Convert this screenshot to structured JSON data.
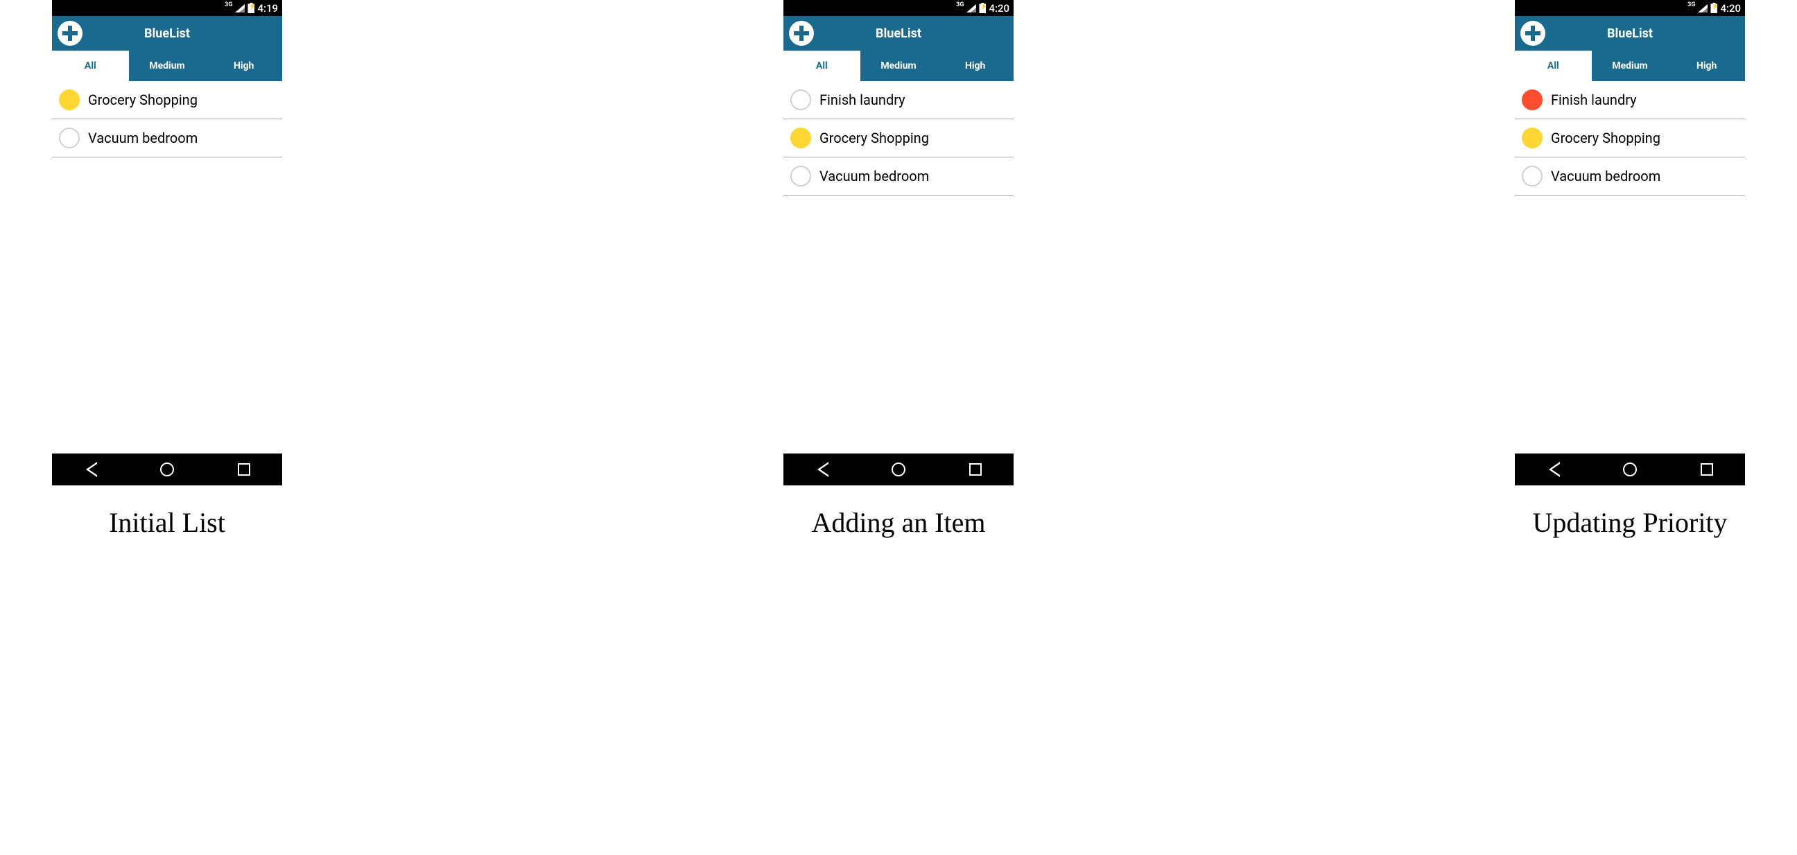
{
  "colors": {
    "header_bg": "#1a6a8f",
    "priority_medium": "#ffd633",
    "priority_high": "#ff4d2e"
  },
  "screens": [
    {
      "caption": "Initial List",
      "status": {
        "network": "3G",
        "time": "4:19"
      },
      "header": {
        "title": "BlueList"
      },
      "tabs": [
        {
          "label": "All",
          "active": true
        },
        {
          "label": "Medium",
          "active": false
        },
        {
          "label": "High",
          "active": false
        }
      ],
      "items": [
        {
          "text": "Grocery Shopping",
          "priority": "medium"
        },
        {
          "text": "Vacuum bedroom",
          "priority": "none"
        }
      ]
    },
    {
      "caption": "Adding an Item",
      "status": {
        "network": "3G",
        "time": "4:20"
      },
      "header": {
        "title": "BlueList"
      },
      "tabs": [
        {
          "label": "All",
          "active": true
        },
        {
          "label": "Medium",
          "active": false
        },
        {
          "label": "High",
          "active": false
        }
      ],
      "items": [
        {
          "text": "Finish laundry",
          "priority": "none"
        },
        {
          "text": "Grocery Shopping",
          "priority": "medium"
        },
        {
          "text": "Vacuum bedroom",
          "priority": "none"
        }
      ]
    },
    {
      "caption": "Updating Priority",
      "status": {
        "network": "3G",
        "time": "4:20"
      },
      "header": {
        "title": "BlueList"
      },
      "tabs": [
        {
          "label": "All",
          "active": true
        },
        {
          "label": "Medium",
          "active": false
        },
        {
          "label": "High",
          "active": false
        }
      ],
      "items": [
        {
          "text": "Finish laundry",
          "priority": "high"
        },
        {
          "text": "Grocery Shopping",
          "priority": "medium"
        },
        {
          "text": "Vacuum bedroom",
          "priority": "none"
        }
      ]
    }
  ]
}
